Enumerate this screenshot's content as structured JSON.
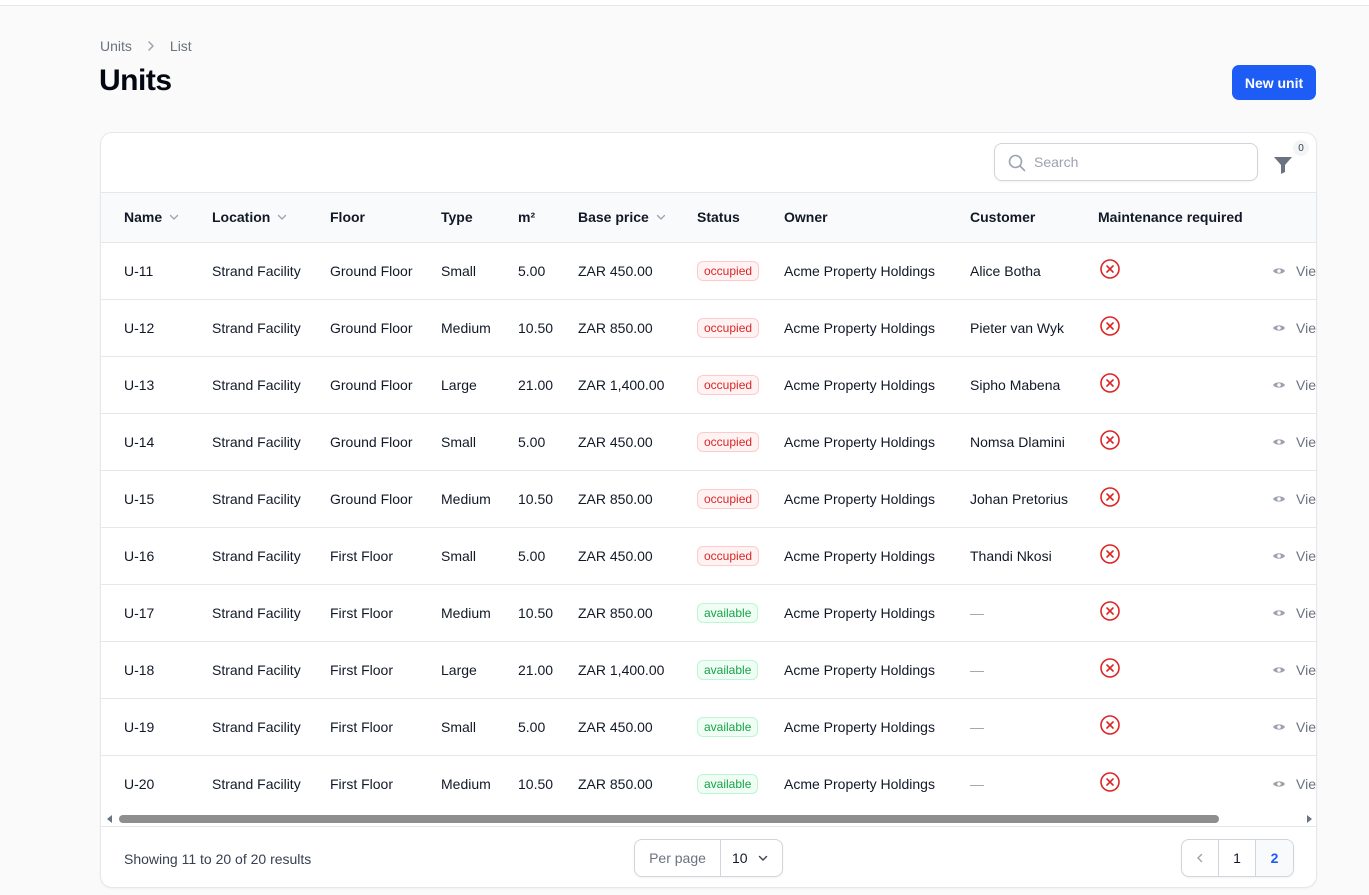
{
  "breadcrumb": {
    "items": [
      "Units",
      "List"
    ]
  },
  "page": {
    "title": "Units",
    "new_button": "New unit"
  },
  "toolbar": {
    "search_placeholder": "Search",
    "filter_count": "0"
  },
  "table": {
    "headers": {
      "name": "Name",
      "location": "Location",
      "floor": "Floor",
      "type": "Type",
      "area": "m²",
      "base_price": "Base price",
      "status": "Status",
      "owner": "Owner",
      "customer": "Customer",
      "maintenance": "Maintenance required"
    },
    "view_label": "View",
    "rows": [
      {
        "name": "U-11",
        "location": "Strand Facility",
        "floor": "Ground Floor",
        "type": "Small",
        "area": "5.00",
        "price": "ZAR 450.00",
        "status": "occupied",
        "owner": "Acme Property Holdings",
        "customer": "Alice Botha"
      },
      {
        "name": "U-12",
        "location": "Strand Facility",
        "floor": "Ground Floor",
        "type": "Medium",
        "area": "10.50",
        "price": "ZAR 850.00",
        "status": "occupied",
        "owner": "Acme Property Holdings",
        "customer": "Pieter van Wyk"
      },
      {
        "name": "U-13",
        "location": "Strand Facility",
        "floor": "Ground Floor",
        "type": "Large",
        "area": "21.00",
        "price": "ZAR 1,400.00",
        "status": "occupied",
        "owner": "Acme Property Holdings",
        "customer": "Sipho Mabena"
      },
      {
        "name": "U-14",
        "location": "Strand Facility",
        "floor": "Ground Floor",
        "type": "Small",
        "area": "5.00",
        "price": "ZAR 450.00",
        "status": "occupied",
        "owner": "Acme Property Holdings",
        "customer": "Nomsa Dlamini"
      },
      {
        "name": "U-15",
        "location": "Strand Facility",
        "floor": "Ground Floor",
        "type": "Medium",
        "area": "10.50",
        "price": "ZAR 850.00",
        "status": "occupied",
        "owner": "Acme Property Holdings",
        "customer": "Johan Pretorius"
      },
      {
        "name": "U-16",
        "location": "Strand Facility",
        "floor": "First Floor",
        "type": "Small",
        "area": "5.00",
        "price": "ZAR 450.00",
        "status": "occupied",
        "owner": "Acme Property Holdings",
        "customer": "Thandi Nkosi"
      },
      {
        "name": "U-17",
        "location": "Strand Facility",
        "floor": "First Floor",
        "type": "Medium",
        "area": "10.50",
        "price": "ZAR 850.00",
        "status": "available",
        "owner": "Acme Property Holdings",
        "customer": "—"
      },
      {
        "name": "U-18",
        "location": "Strand Facility",
        "floor": "First Floor",
        "type": "Large",
        "area": "21.00",
        "price": "ZAR 1,400.00",
        "status": "available",
        "owner": "Acme Property Holdings",
        "customer": "—"
      },
      {
        "name": "U-19",
        "location": "Strand Facility",
        "floor": "First Floor",
        "type": "Small",
        "area": "5.00",
        "price": "ZAR 450.00",
        "status": "available",
        "owner": "Acme Property Holdings",
        "customer": "—"
      },
      {
        "name": "U-20",
        "location": "Strand Facility",
        "floor": "First Floor",
        "type": "Medium",
        "area": "10.50",
        "price": "ZAR 850.00",
        "status": "available",
        "owner": "Acme Property Holdings",
        "customer": "—"
      }
    ]
  },
  "footer": {
    "results_text": "Showing 11 to 20 of 20 results",
    "per_page_label": "Per page",
    "per_page_value": "10",
    "pages": [
      "1",
      "2"
    ],
    "current_page": "2"
  },
  "colors": {
    "primary": "#1d5cf5",
    "danger": "#dc2626",
    "success": "#16a34a"
  }
}
